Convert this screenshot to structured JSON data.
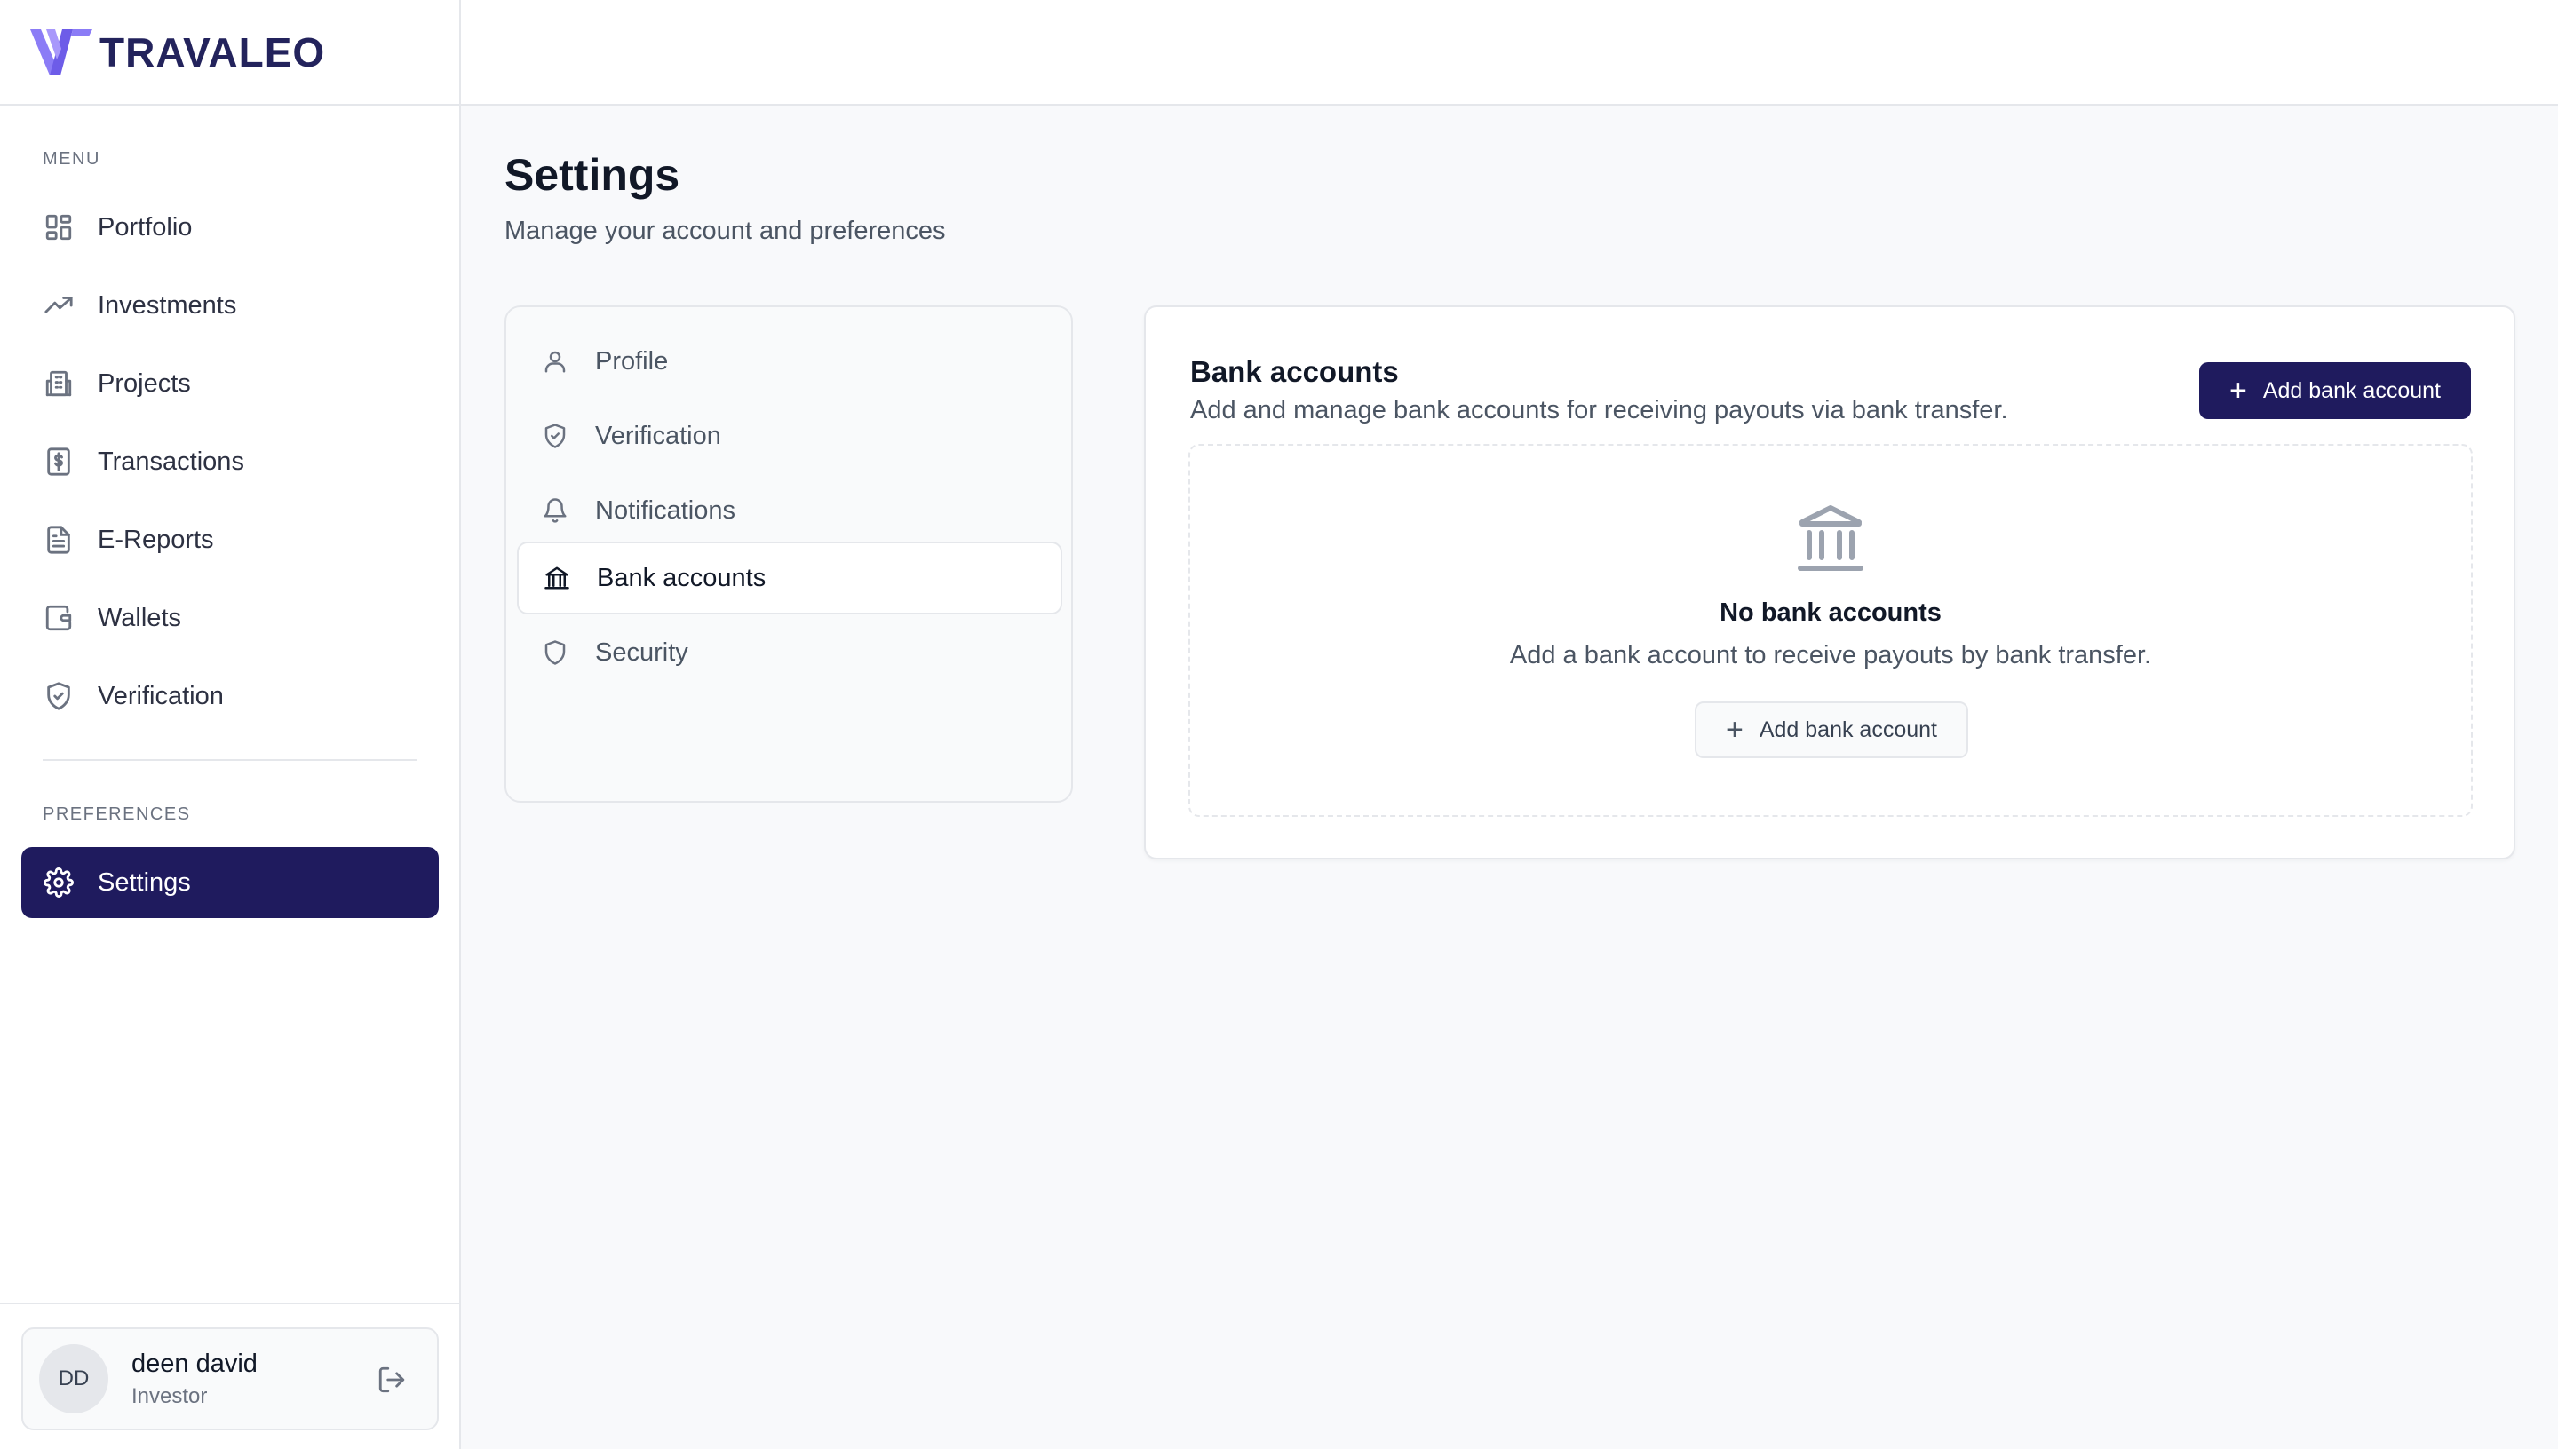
{
  "brand": {
    "name": "TRAVALEO"
  },
  "sidebar": {
    "menu_label": "MENU",
    "items": [
      {
        "label": "Portfolio",
        "icon": "grid-icon"
      },
      {
        "label": "Investments",
        "icon": "trending-up-icon"
      },
      {
        "label": "Projects",
        "icon": "building-icon"
      },
      {
        "label": "Transactions",
        "icon": "dollar-receipt-icon"
      },
      {
        "label": "E-Reports",
        "icon": "document-icon"
      },
      {
        "label": "Wallets",
        "icon": "wallet-icon"
      },
      {
        "label": "Verification",
        "icon": "shield-check-icon"
      }
    ],
    "preferences_label": "PREFERENCES",
    "settings": {
      "label": "Settings",
      "icon": "gear-icon"
    }
  },
  "user": {
    "initials": "DD",
    "name": "deen david",
    "role": "Investor"
  },
  "page": {
    "title": "Settings",
    "subtitle": "Manage your account and preferences"
  },
  "settings_menu": {
    "items": [
      {
        "label": "Profile",
        "icon": "user-icon"
      },
      {
        "label": "Verification",
        "icon": "shield-check-icon"
      },
      {
        "label": "Notifications",
        "icon": "bell-icon"
      },
      {
        "label": "Bank accounts",
        "icon": "bank-icon",
        "active": true
      },
      {
        "label": "Security",
        "icon": "shield-icon"
      }
    ]
  },
  "bank_accounts": {
    "title": "Bank accounts",
    "description": "Add and manage bank accounts for receiving payouts via bank transfer.",
    "add_button": "Add bank account",
    "empty": {
      "title": "No bank accounts",
      "description": "Add a bank account to receive payouts by bank transfer.",
      "button": "Add bank account"
    }
  },
  "colors": {
    "accent": "#1f1b5e",
    "logo": "#7c6bf0"
  }
}
